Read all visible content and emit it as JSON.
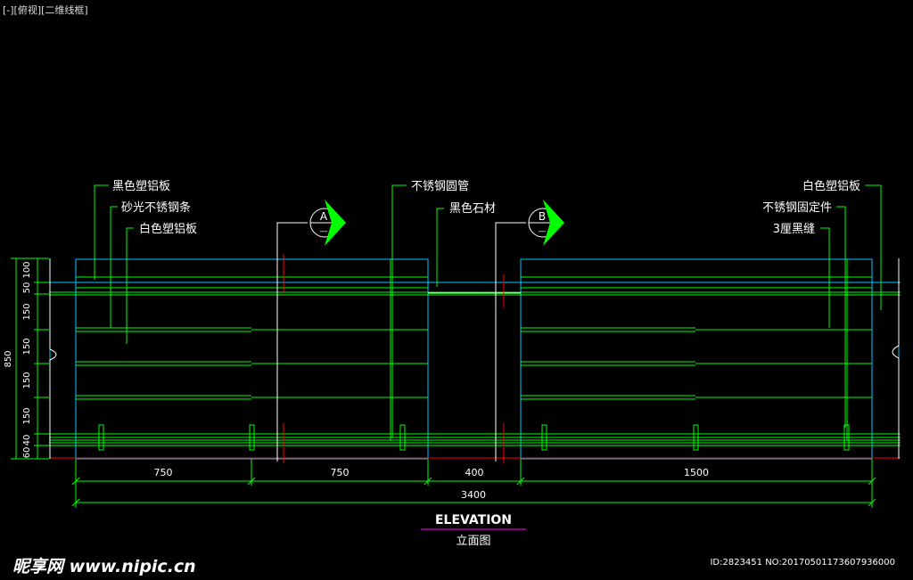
{
  "viewport_label": "[-][俯视][二维线框]",
  "callouts": {
    "left": [
      "黑色塑铝板",
      "砂光不锈钢条",
      "白色塑铝板"
    ],
    "middle": [
      "不锈钢圆管",
      "黑色石材"
    ],
    "right": [
      "白色塑铝板",
      "不锈钢固定件",
      "3厘黑缝"
    ]
  },
  "section_marks": {
    "a": {
      "letter": "A",
      "sub": "—"
    },
    "b": {
      "letter": "B",
      "sub": "—"
    }
  },
  "dims_bottom": {
    "seg1": "750",
    "seg2": "750",
    "seg3": "400",
    "seg4": "1500",
    "total": "3400"
  },
  "dims_left": {
    "d100": "100",
    "d50": "50",
    "d150a": "150",
    "d150b": "150",
    "d150c": "150",
    "d150d": "150",
    "d40": "40",
    "d60": "60",
    "total": "850"
  },
  "title": {
    "en": "ELEVATION",
    "cn": "立面图"
  },
  "watermark": {
    "left": "昵享网 www.nipic.cn",
    "right": "ID:2823451 NO:20170501173607936000"
  },
  "colors": {
    "green": "#00ff00",
    "cyan": "#00c8ff",
    "red": "#ff0000",
    "magenta": "#ff00ff",
    "white": "#ffffff"
  }
}
